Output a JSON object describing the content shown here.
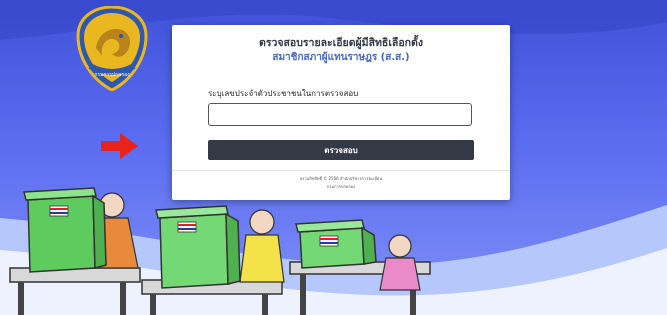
{
  "card": {
    "title": "ตรวจสอบรายละเอียดผู้มีสิทธิเลือกตั้ง",
    "subtitle": "สมาชิกสภาผู้แทนราษฎร (ส.ส.)",
    "field_label": "ระบุเลขประจำตัวประชาชนในการตรวจสอบ",
    "id_value": "",
    "check_button_label": "ตรวจสอบ",
    "footer_line1": "สงวนลิขสิทธิ์ © 2566 สำนักบริหารการทะเบียน",
    "footer_line2": "กรมการปกครอง"
  },
  "colors": {
    "background": "#4a5ce6",
    "title": "#333a45",
    "subtitle": "#4a66c9",
    "button": "#333a45",
    "arrow": "#e8231b",
    "booth_green": "#7ee07e",
    "emblem_gold": "#e9b821",
    "emblem_blue": "#2f56b0"
  },
  "icons": {
    "emblem": "department-of-provincial-administration-seal",
    "arrow": "right-arrow-icon"
  },
  "emblem_text": "กรมการปกครอง"
}
